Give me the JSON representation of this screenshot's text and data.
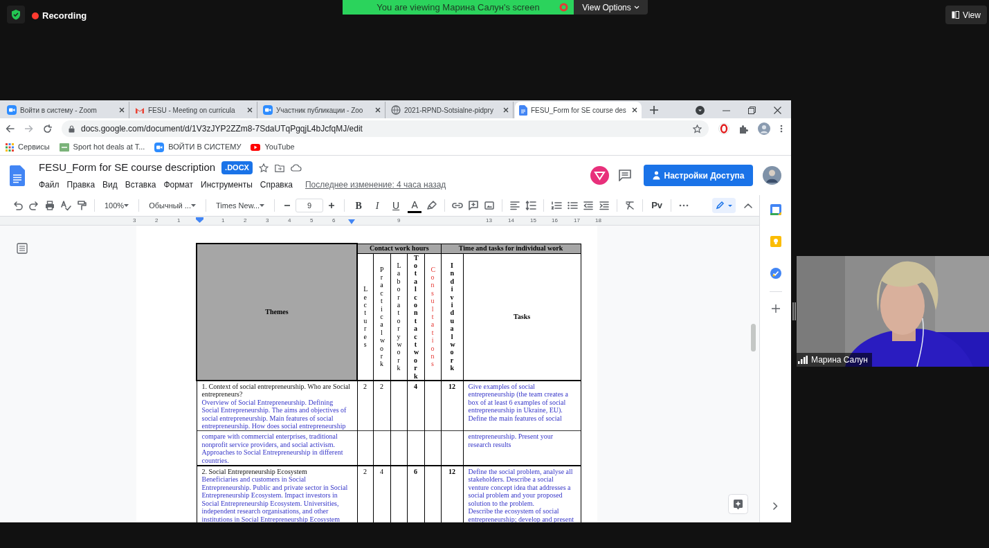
{
  "zoom": {
    "recording": "Recording",
    "banner": "You are viewing Марина Салун's screen",
    "view_options": "View Options",
    "view_button": "View"
  },
  "browser": {
    "tabs": [
      {
        "title": "Войти в систему - Zoom",
        "kind": "zoom",
        "selected": false
      },
      {
        "title": "FESU - Meeting on curricula",
        "kind": "gmail",
        "selected": false
      },
      {
        "title": "Участник публикации - Zoo",
        "kind": "zoom",
        "selected": false
      },
      {
        "title": "2021-RPND-Sotsialne-pidpry",
        "kind": "globe",
        "selected": false
      },
      {
        "title": "FESU_Form for SE course des",
        "kind": "docs",
        "selected": true
      }
    ],
    "url": "docs.google.com/document/d/1V3zJYP2ZZm8-7SdaUTqPgqjL4bJcfqMJ/edit",
    "bookmarks": [
      {
        "label": "Сервисы",
        "kind": "apps"
      },
      {
        "label": "Sport hot deals at T...",
        "kind": "deals"
      },
      {
        "label": "ВОЙТИ В СИСТЕМУ",
        "kind": "zoom"
      },
      {
        "label": "YouTube",
        "kind": "youtube"
      }
    ]
  },
  "doc": {
    "title": "FESU_Form for SE course description",
    "badge": ".DOCX",
    "menus": [
      "Файл",
      "Правка",
      "Вид",
      "Вставка",
      "Формат",
      "Инструменты",
      "Справка"
    ],
    "last_edit": "Последнее изменение: 4 часа назад",
    "share_button": "Настройки Доступа",
    "toolbar": {
      "zoom": "100%",
      "style": "Обычный ...",
      "font": "Times New...",
      "font_size": "9",
      "format_buttons": [
        {
          "label": "B",
          "kind": "bold"
        },
        {
          "label": "I",
          "kind": "italic"
        },
        {
          "label": "U",
          "kind": "underline"
        },
        {
          "label": "A",
          "kind": "color"
        }
      ],
      "input_tools": "Pv"
    },
    "ruler": [
      "3",
      "2",
      "1",
      "1",
      "2",
      "3",
      "4",
      "5",
      "6",
      "9",
      "13",
      "14",
      "15",
      "16",
      "17",
      "18"
    ]
  },
  "table": {
    "themes_header": "Themes",
    "groups": [
      "Contact work hours",
      "Time and tasks for individual work"
    ],
    "columns": [
      {
        "label": "Lectures",
        "bold": false
      },
      {
        "label": "Practical work",
        "bold": false
      },
      {
        "label": "Laboratory work",
        "bold": false
      },
      {
        "label": "Total contact work",
        "bold": true
      },
      {
        "label": "Consultations",
        "bold": false,
        "color": "#e53935"
      },
      {
        "label": "Individual work",
        "bold": true
      }
    ],
    "tasks_header": "Tasks",
    "rows": [
      {
        "kind": "row",
        "title": "1. Context of social entrepreneurship. Who are Social entrepreneurs?",
        "description": "Overview of Social Entrepreneurship. Defining Social Entrepreneurship. The aims and objectives of social entrepreneurship. Main features of social entrepreneurship. How does social entrepreneurship",
        "cells": [
          "2",
          "2",
          null,
          "4",
          null,
          "12"
        ],
        "tasks": "Give examples of social entrepreneurship (the team creates a box of at least 6 examples of social entrepreneurship in Ukraine, EU). Define the main features of social"
      },
      {
        "kind": "continuation",
        "description": "compare with commercial enterprises, traditional nonprofit service providers, and social activism. Approaches to Social Entrepreneurship  in different countries.",
        "tasks": "entrepreneurship. Present your research results"
      },
      {
        "kind": "row",
        "title": "2. Social Entrepreneurship Ecosystem",
        "description": "Beneficiaries and customers in Social Entrepreneurship. Public and private sector in Social Entrepreneurship Ecosystem. Impact investors in Social Entrepreneurship Ecosystem. Universities, independent research organisations, and other institutions in Social Entrepreneurship Ecosystem",
        "cells": [
          "2",
          "4",
          null,
          "6",
          null,
          "12"
        ],
        "tasks": "Define the social problem, analyse all stakeholders. Describe a social venture concept idea that addresses a social problem and your proposed solution to the problem.\nDescribe the ecosystem of social entrepreneurship; develop and present"
      }
    ]
  },
  "participant": {
    "name": "Марина Салун"
  }
}
